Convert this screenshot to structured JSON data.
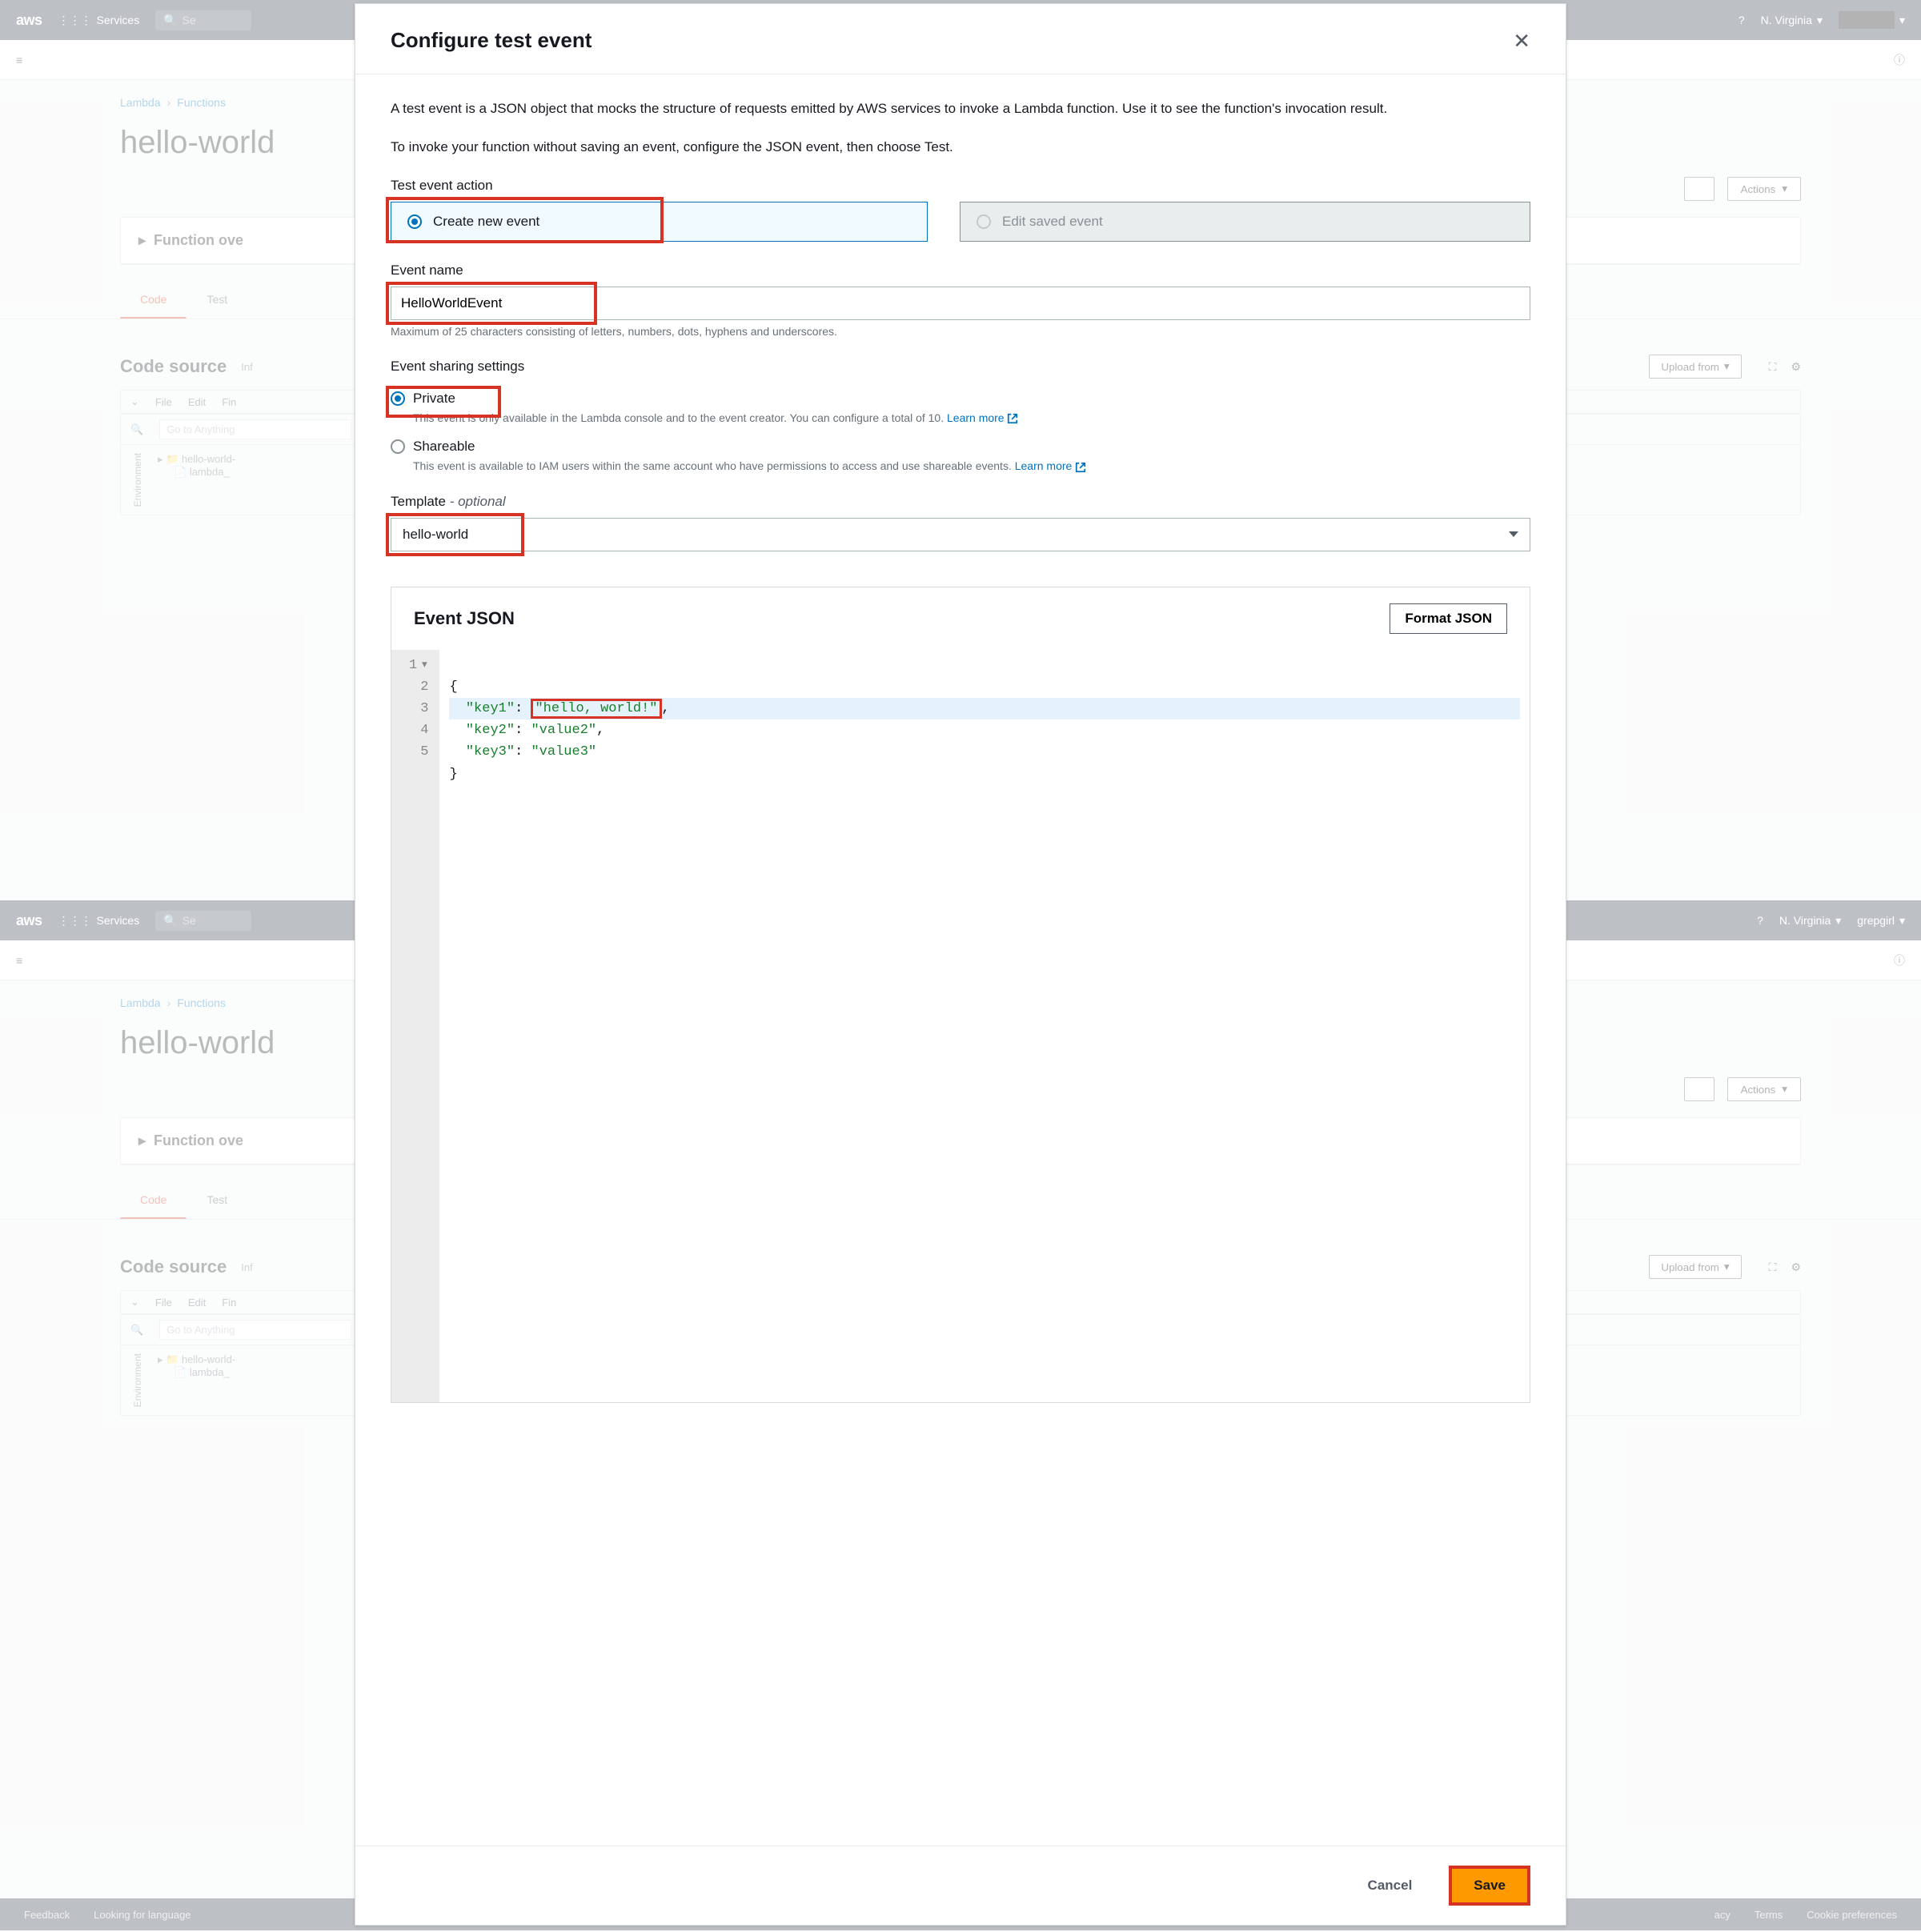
{
  "header": {
    "logo": "aws",
    "services": "Services",
    "search_placeholder": "Se",
    "region": "N. Virginia",
    "user": "grepgirl"
  },
  "breadcrumb": {
    "a": "Lambda",
    "b": "Functions"
  },
  "page": {
    "title": "hello-world",
    "overview": "Function ove",
    "tabs": {
      "code": "Code",
      "test": "Test"
    },
    "code_source": "Code source",
    "info": "Inf",
    "upload": "Upload from",
    "actions": "Actions",
    "file": "File",
    "edit": "Edit",
    "find": "Fin",
    "goto": "Go to Anything",
    "env": "Environment",
    "tree_a": "hello-world-",
    "tree_b": "lambda_"
  },
  "modal": {
    "title": "Configure test event",
    "p1": "A test event is a JSON object that mocks the structure of requests emitted by AWS services to invoke a Lambda function. Use it to see the function's invocation result.",
    "p2": "To invoke your function without saving an event, configure the JSON event, then choose Test.",
    "action_label": "Test event action",
    "create_new": "Create new event",
    "edit_saved": "Edit saved event",
    "event_name_label": "Event name",
    "event_name_value": "HelloWorldEvent",
    "event_name_hint": "Maximum of 25 characters consisting of letters, numbers, dots, hyphens and underscores.",
    "sharing_label": "Event sharing settings",
    "private_label": "Private",
    "private_hint": "This event is only available in the Lambda console and to the event creator. You can configure a total of 10.",
    "shareable_label": "Shareable",
    "shareable_hint": "This event is available to IAM users within the same account who have permissions to access and use shareable events.",
    "learn_more": "Learn more",
    "template_label": "Template",
    "template_opt": " - optional",
    "template_value": "hello-world",
    "json_title": "Event JSON",
    "format_json": "Format JSON",
    "json_lines": [
      "1",
      "2",
      "3",
      "4",
      "5"
    ],
    "json": {
      "l1_open": "{",
      "k1": "\"key1\"",
      "v1": "\"hello, world!\"",
      "k2": "\"key2\"",
      "v2": "\"value2\"",
      "k3": "\"key3\"",
      "v3": "\"value3\"",
      "l5_close": "}"
    },
    "cancel": "Cancel",
    "save": "Save"
  },
  "footer": {
    "feedback": "Feedback",
    "lang": "Looking for language",
    "privacy": "acy",
    "terms": "Terms",
    "cookie": "Cookie preferences"
  }
}
